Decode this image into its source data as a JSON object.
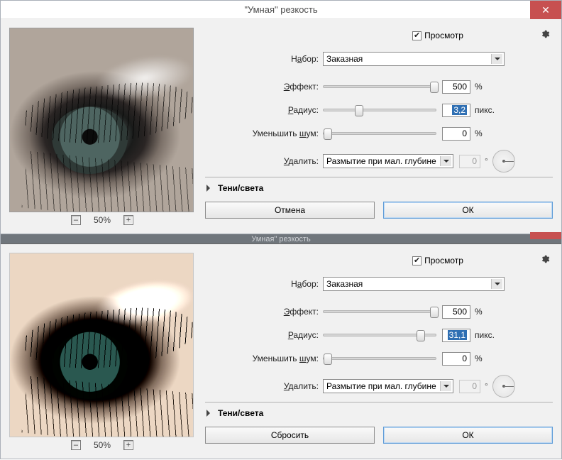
{
  "dialog1": {
    "title": "\"Умная\" резкость",
    "preview_checkbox_label": "Просмотр",
    "zoom_level": "50%",
    "preset_label_pre": "Н",
    "preset_label_u": "а",
    "preset_label_post": "бор:",
    "preset_value": "Заказная",
    "amount_label_pre": "",
    "amount_label_u": "Э",
    "amount_label_post": "ффект:",
    "amount_value": "500",
    "amount_unit": "%",
    "radius_label_pre": "",
    "radius_label_u": "Р",
    "radius_label_post": "адиус:",
    "radius_value": "3,2",
    "radius_unit": "пикс.",
    "noise_label_pre": "Уменьшить ",
    "noise_label_u": "ш",
    "noise_label_post": "ум:",
    "noise_value": "0",
    "noise_unit": "%",
    "remove_label_pre": "",
    "remove_label_u": "У",
    "remove_label_post": "далить:",
    "remove_value": "Размытие при мал. глубине",
    "angle_value": "0",
    "shadows_section": "Тени/света",
    "cancel": "Отмена",
    "ok": "ОК"
  },
  "dialog2": {
    "title": "Умная\" резкость",
    "preview_checkbox_label": "Просмотр",
    "zoom_level": "50%",
    "preset_label_pre": "Н",
    "preset_label_u": "а",
    "preset_label_post": "бор:",
    "preset_value": "Заказная",
    "amount_label_pre": "",
    "amount_label_u": "Э",
    "amount_label_post": "ффект:",
    "amount_value": "500",
    "amount_unit": "%",
    "radius_label_pre": "",
    "radius_label_u": "Р",
    "radius_label_post": "адиус:",
    "radius_value": "31,1",
    "radius_unit": "пикс.",
    "noise_label_pre": "Уменьшить ",
    "noise_label_u": "ш",
    "noise_label_post": "ум:",
    "noise_value": "0",
    "noise_unit": "%",
    "remove_label_pre": "",
    "remove_label_u": "У",
    "remove_label_post": "далить:",
    "remove_value": "Размытие при мал. глубине",
    "angle_value": "0",
    "shadows_section": "Тени/света",
    "cancel": "Сбросить",
    "ok": "ОК"
  },
  "slider_positions": {
    "d1_amount_pct": 95,
    "d1_radius_pct": 30,
    "d1_noise_pct": 0,
    "d2_amount_pct": 95,
    "d2_radius_pct": 85,
    "d2_noise_pct": 0
  }
}
